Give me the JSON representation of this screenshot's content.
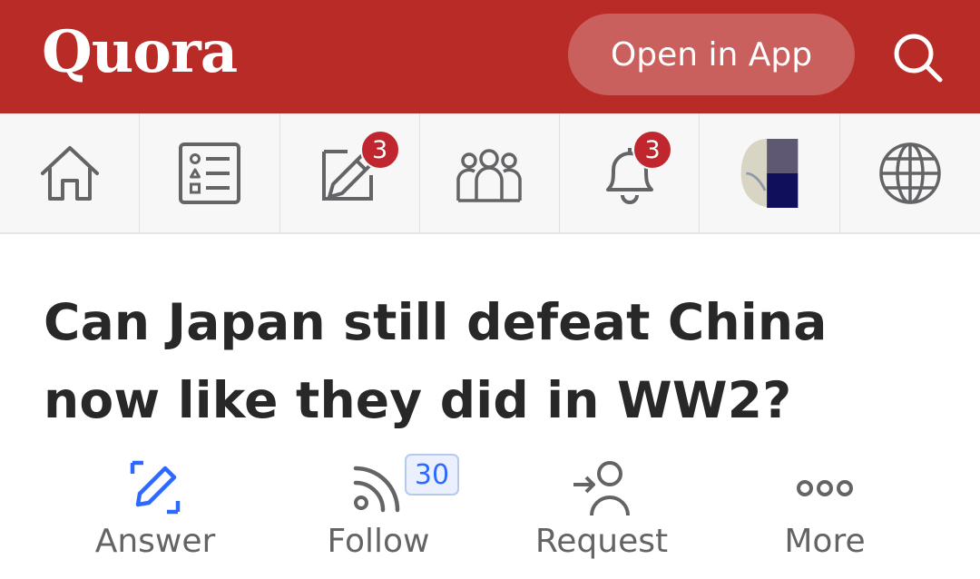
{
  "header": {
    "logo": "Quora",
    "open_in_app": "Open in App",
    "search_icon": "search-icon",
    "background": "#b92b27"
  },
  "nav": {
    "items": [
      {
        "icon": "home-icon"
      },
      {
        "icon": "following-list-icon"
      },
      {
        "icon": "write-icon",
        "badge": "3"
      },
      {
        "icon": "spaces-icon"
      },
      {
        "icon": "bell-icon",
        "badge": "3"
      },
      {
        "icon": "profile-avatar"
      },
      {
        "icon": "globe-icon"
      }
    ]
  },
  "question": {
    "title": "Can Japan still defeat China now like they did in WW2?"
  },
  "actions": {
    "answer": {
      "label": "Answer",
      "icon": "pencil-icon",
      "color": "#2e69ff"
    },
    "follow": {
      "label": "Follow",
      "icon": "rss-icon",
      "count": "30"
    },
    "request": {
      "label": "Request",
      "icon": "request-user-icon"
    },
    "more": {
      "label": "More",
      "icon": "more-dots-icon"
    }
  }
}
